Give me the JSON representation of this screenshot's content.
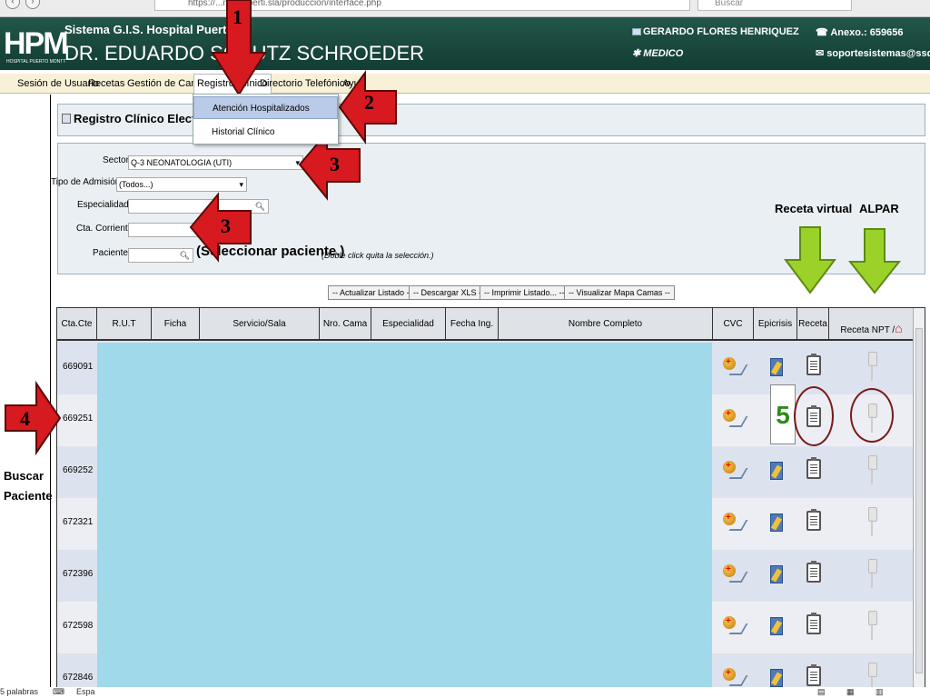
{
  "browser": {
    "url": "https://...ntotexperti.sla/produccion/interface.php",
    "search_placeholder": "Buscar"
  },
  "header": {
    "logo": "HPM",
    "logo_sub": "HOSPITAL PUERTO MONTT",
    "system": "Sistema G.I.S. Hospital Puerto M",
    "hospital": "DR. EDUARDO SCHUTZ SCHROEDER",
    "user": "GERARDO FLORES HENRIQUEZ",
    "role": "MEDICO",
    "anexo": "Anexo.: 659656",
    "email": "soportesistemas@ssdr.gob.c"
  },
  "menu": {
    "items": [
      "Sesión de Usuario",
      "Recetas",
      "Gestión de Camas",
      "Registro Clínico",
      "Directorio Telefónico",
      "Ayu"
    ],
    "active": "Registro Clínico",
    "dropdown": [
      "Atención Hospitalizados",
      "Historial Clínico"
    ]
  },
  "panel": {
    "title": "Registro Clínico Electróni"
  },
  "form": {
    "sector_label": "Sector:",
    "sector_value": "Q-3 NEONATOLOGIA (UTI)",
    "tipo_label": "Tipo de Admisión:",
    "tipo_value": "(Todos...)",
    "especialidad_label": "Especialidad:",
    "cta_label": "Cta. Corriente:",
    "paciente_label": "Paciente:",
    "select_patient": "(Seleccionar paciente.)",
    "hint": "(Doble click quita la selección.)"
  },
  "actions": [
    "-- Actualizar Listado --",
    "-- Descargar XLS --",
    "-- Imprimir Listado... --",
    "-- Visualizar Mapa Camas --"
  ],
  "table": {
    "columns": [
      "Cta.Cte",
      "R.U.T",
      "Ficha",
      "Servicio/Sala",
      "Nro. Cama",
      "Especialidad",
      "Fecha Ing.",
      "Nombre Completo",
      "CVC",
      "Epicrisis",
      "Receta",
      "Receta NPT /"
    ],
    "rows": [
      {
        "cta": "669091"
      },
      {
        "cta": "669251"
      },
      {
        "cta": "669252"
      },
      {
        "cta": "672321"
      },
      {
        "cta": "672396"
      },
      {
        "cta": "672598"
      },
      {
        "cta": "672846"
      }
    ]
  },
  "annotations": {
    "n1": "1",
    "n2": "2",
    "n3a": "3",
    "n3b": "3",
    "n4": "4",
    "n5": "5",
    "buscar_paciente": "Buscar Paciente",
    "receta_virtual": "Receta virtual",
    "alpar": "ALPAR",
    "red": "#d71920",
    "green": "#9bd22a"
  },
  "footer": {
    "words": "5 palabras",
    "lang": "Espa"
  }
}
